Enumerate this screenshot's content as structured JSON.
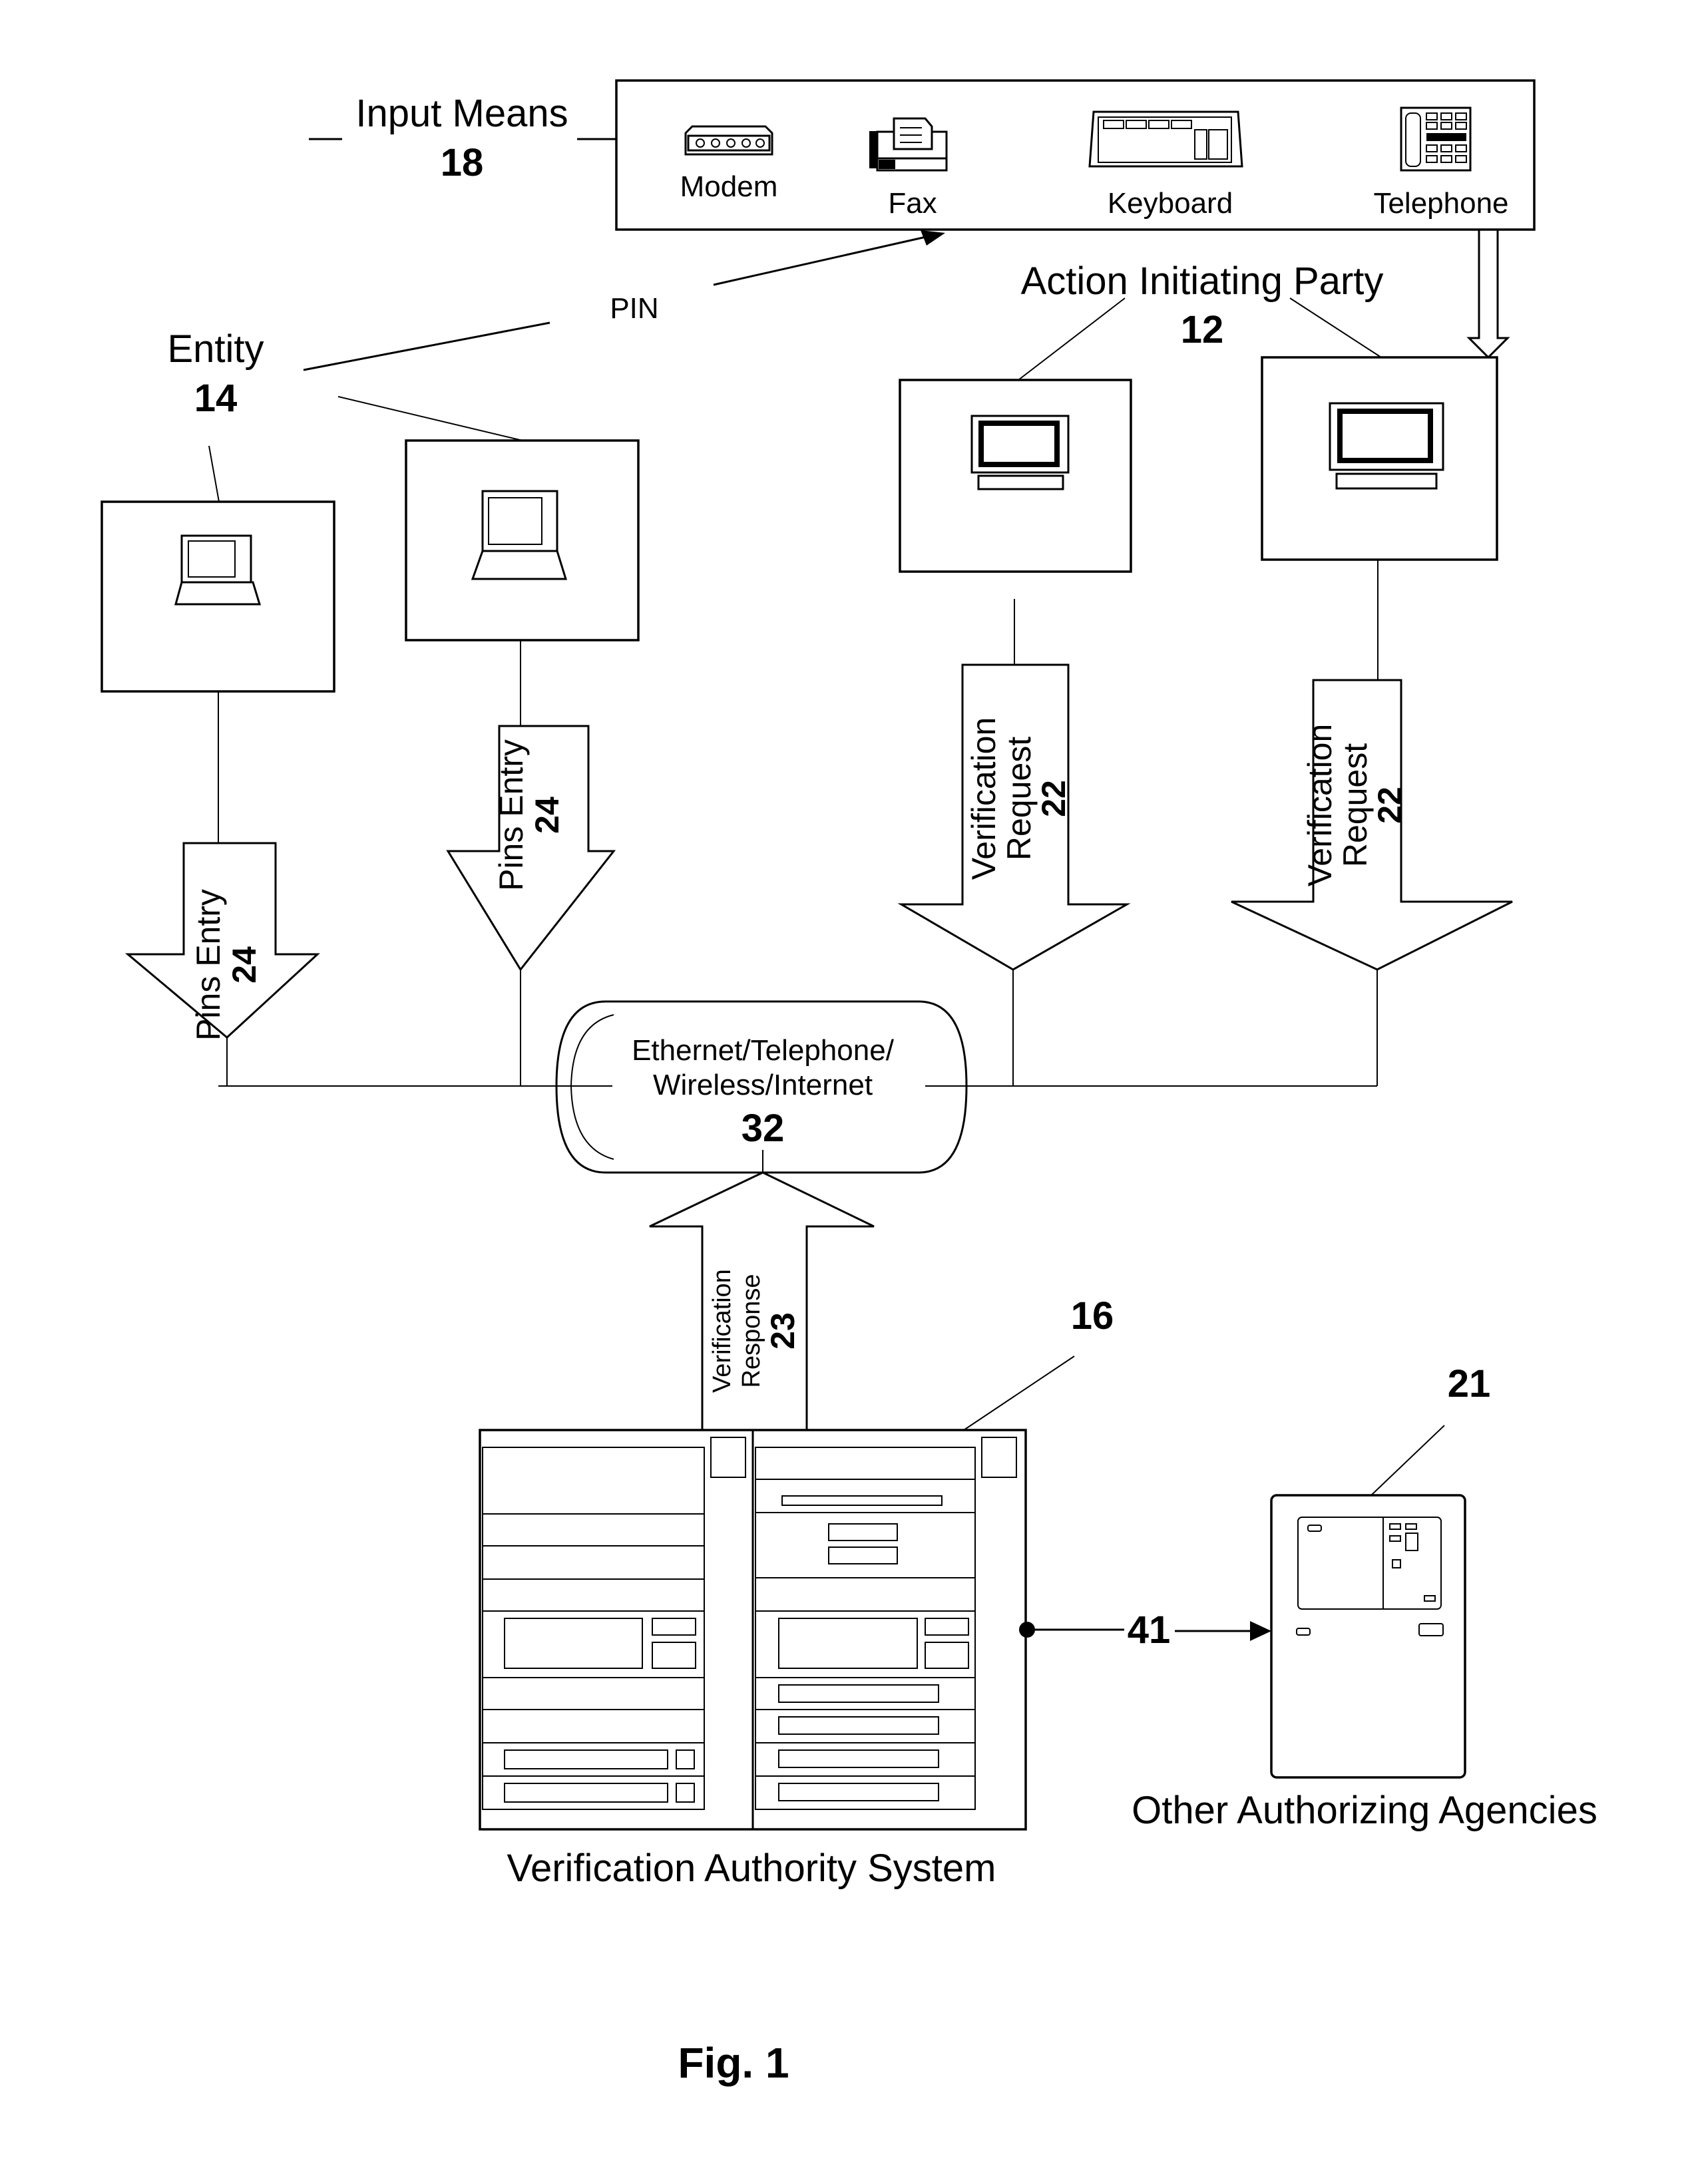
{
  "figure": {
    "caption": "Fig. 1",
    "input_means": {
      "label": "Input Means",
      "ref": "18",
      "devices": [
        {
          "label": "Modem",
          "icon": "modem-icon"
        },
        {
          "label": "Fax",
          "icon": "fax-icon"
        },
        {
          "label": "Keyboard",
          "icon": "keyboard-icon"
        },
        {
          "label": "Telephone",
          "icon": "telephone-icon"
        }
      ]
    },
    "pin_label": "PIN",
    "entity": {
      "label": "Entity",
      "ref": "14",
      "devices": [
        "laptop-icon",
        "laptop-icon"
      ]
    },
    "action_initiating_party": {
      "label": "Action Initiating Party",
      "ref": "12",
      "devices": [
        "desktop-computer-icon",
        "desktop-computer-icon"
      ]
    },
    "arrows": {
      "pins_entry": {
        "label": "Pins Entry",
        "ref": "24"
      },
      "verification_request": {
        "line1": "Verification",
        "line2": "Request",
        "ref": "22"
      },
      "verification_response": {
        "line1": "Verification",
        "line2": "Response",
        "ref": "23"
      }
    },
    "network": {
      "line1": "Ethernet/Telephone/",
      "line2": "Wireless/Internet",
      "ref": "32"
    },
    "verification_authority": {
      "label": "Verification Authority System",
      "ref": "16"
    },
    "link": {
      "ref": "41"
    },
    "other_agencies": {
      "label": "Other Authorizing Agencies",
      "ref": "21"
    }
  }
}
